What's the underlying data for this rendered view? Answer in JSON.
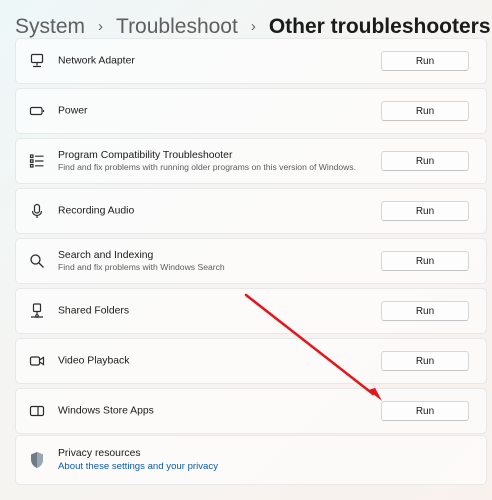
{
  "breadcrumb": {
    "items": [
      "System",
      "Troubleshoot",
      "Other troubleshooters"
    ],
    "separator": "›"
  },
  "troubleshooters": [
    {
      "title": "Network Adapter",
      "description": "",
      "icon": "network-adapter-icon",
      "run_label": "Run"
    },
    {
      "title": "Power",
      "description": "",
      "icon": "battery-icon",
      "run_label": "Run"
    },
    {
      "title": "Program Compatibility Troubleshooter",
      "description": "Find and fix problems with running older programs on this version of Windows.",
      "icon": "list-icon",
      "run_label": "Run"
    },
    {
      "title": "Recording Audio",
      "description": "",
      "icon": "microphone-icon",
      "run_label": "Run"
    },
    {
      "title": "Search and Indexing",
      "description": "Find and fix problems with Windows Search",
      "icon": "search-icon",
      "run_label": "Run"
    },
    {
      "title": "Shared Folders",
      "description": "",
      "icon": "network-drive-icon",
      "run_label": "Run"
    },
    {
      "title": "Video Playback",
      "description": "",
      "icon": "video-camera-icon",
      "run_label": "Run"
    },
    {
      "title": "Windows Store Apps",
      "description": "",
      "icon": "store-app-icon",
      "run_label": "Run"
    }
  ],
  "privacy": {
    "title": "Privacy resources",
    "link": "About these settings and your privacy",
    "icon": "shield-icon"
  },
  "annotation": {
    "color": "#e8141b",
    "target": "Windows Store Apps run button"
  }
}
